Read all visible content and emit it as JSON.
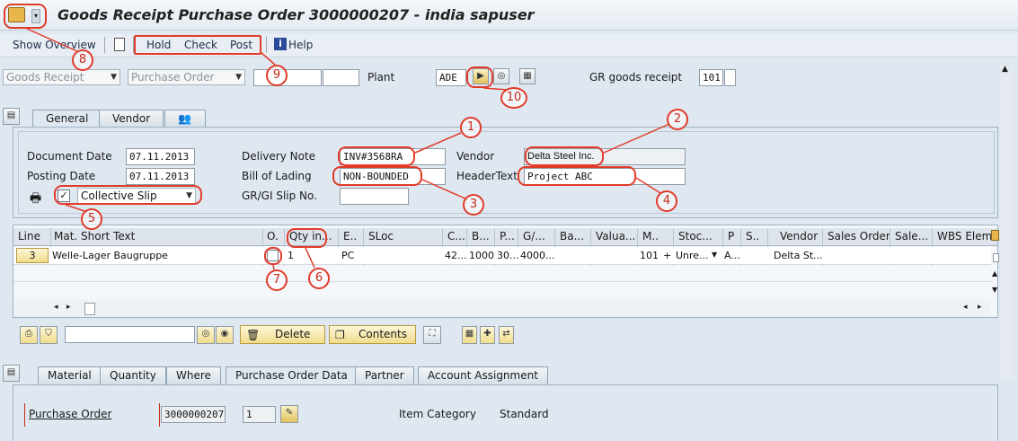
{
  "window": {
    "title": "Goods Receipt Purchase Order 3000000207 - india sapuser"
  },
  "toolbar": {
    "show_overview": "Show Overview",
    "hold": "Hold",
    "check": "Check",
    "post": "Post",
    "help": "Help"
  },
  "header_row": {
    "transaction": "Goods Receipt",
    "reference": "Purchase Order",
    "plant_label": "Plant",
    "plant_value": "ADE",
    "gr_label": "GR goods receipt",
    "gr_value": "101"
  },
  "tabs_top": [
    "General",
    "Vendor"
  ],
  "general": {
    "doc_date_label": "Document Date",
    "doc_date": "07.11.2013",
    "post_date_label": "Posting Date",
    "post_date": "07.11.2013",
    "slip_option": "Collective Slip",
    "delivery_note_label": "Delivery Note",
    "delivery_note": "INV#3568RA",
    "bill_label": "Bill of Lading",
    "bill": "NON-BOUNDED",
    "grgi_label": "GR/GI Slip No.",
    "vendor_label": "Vendor",
    "vendor": "Delta Steel Inc.",
    "header_text_label": "HeaderText",
    "header_text": "Project ABC"
  },
  "grid": {
    "headers": [
      "Line",
      "Mat. Short Text",
      "O.",
      "Qty in...",
      "E..",
      "SLoc",
      "C...",
      "B...",
      "P...",
      "G/...",
      "Ba...",
      "Valua...",
      "M..",
      "Stoc...",
      "P",
      "S..",
      "Vendor",
      "Sales Order",
      "Sale...",
      "WBS Eleme"
    ],
    "row": {
      "line": "3",
      "text": "Welle-Lager Baugruppe",
      "qty": "1",
      "unit": "PC",
      "c": "42...",
      "b": "1000",
      "p": "30...",
      "g": "4000...",
      "m": "101",
      "plus": "+",
      "stock": "Unre...",
      "pcol": "A...",
      "vendor": "Delta St..."
    }
  },
  "grid_toolbar": {
    "delete": "Delete",
    "contents": "Contents"
  },
  "tabs_bottom": [
    "Material",
    "Quantity",
    "Where",
    "Purchase Order Data",
    "Partner",
    "Account Assignment"
  ],
  "po_data": {
    "po_label": "Purchase Order",
    "po_number": "3000000207",
    "item": "1",
    "item_cat_label": "Item Category",
    "item_cat": "Standard"
  },
  "callouts": [
    "1",
    "2",
    "3",
    "4",
    "5",
    "6",
    "7",
    "8",
    "9",
    "10"
  ]
}
